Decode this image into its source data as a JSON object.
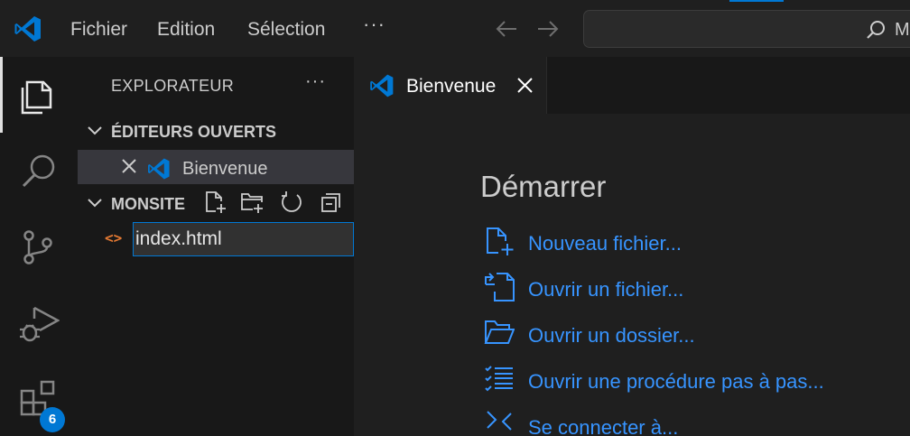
{
  "colors": {
    "accent": "#0078d4",
    "link": "#3794ff",
    "file_icon": "#e37933",
    "background": "#1f1f1f",
    "sidebar": "#181818"
  },
  "titlebar": {
    "menu": [
      "Fichier",
      "Edition",
      "Sélection"
    ],
    "more_label": "···",
    "search_text": "M"
  },
  "activity_bar": {
    "items": [
      "explorer-icon",
      "search-icon",
      "source-control-icon",
      "run-debug-icon",
      "extensions-icon"
    ],
    "extensions_badge": "6"
  },
  "sidebar": {
    "title": "EXPLORATEUR",
    "more_label": "···",
    "open_editors": {
      "label": "ÉDITEURS OUVERTS",
      "items": [
        "Bienvenue"
      ]
    },
    "folder": {
      "label": "MONSITE",
      "tools": [
        "new-file-icon",
        "new-folder-icon",
        "refresh-icon",
        "collapse-all-icon"
      ]
    },
    "rename_input": {
      "file_icon": "<>",
      "value": "index.html"
    }
  },
  "editor": {
    "tabs": [
      {
        "label": "Bienvenue"
      }
    ],
    "welcome": {
      "heading": "Démarrer",
      "actions": [
        {
          "label": "Nouveau fichier...",
          "icon": "new-file-icon"
        },
        {
          "label": "Ouvrir un fichier...",
          "icon": "open-file-icon"
        },
        {
          "label": "Ouvrir un dossier...",
          "icon": "open-folder-icon"
        },
        {
          "label": "Ouvrir une procédure pas à pas...",
          "icon": "walkthrough-icon"
        },
        {
          "label": "Se connecter à...",
          "icon": "remote-connect-icon"
        }
      ]
    }
  }
}
